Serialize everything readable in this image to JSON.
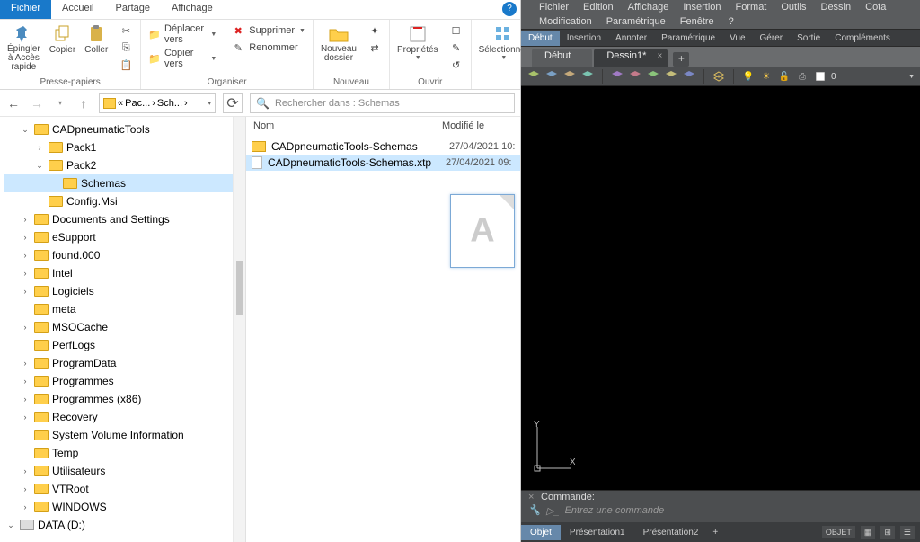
{
  "explorer": {
    "tabs": {
      "file": "Fichier",
      "home": "Accueil",
      "share": "Partage",
      "view": "Affichage"
    },
    "ribbon": {
      "pin": "Épingler à Accès rapide",
      "copy": "Copier",
      "paste": "Coller",
      "clipboard_group": "Presse-papiers",
      "move_to": "Déplacer vers",
      "copy_to": "Copier vers",
      "delete": "Supprimer",
      "rename": "Renommer",
      "organize_group": "Organiser",
      "new_folder": "Nouveau dossier",
      "new_group": "Nouveau",
      "properties": "Propriétés",
      "open_group": "Ouvrir",
      "select": "Sélectionner"
    },
    "breadcrumb": {
      "p1": "Pac...",
      "p2": "Sch..."
    },
    "search_placeholder": "Rechercher dans : Schemas",
    "columns": {
      "name": "Nom",
      "modified": "Modifié le"
    },
    "files": [
      {
        "icon": "folder",
        "name": "CADpneumaticTools-Schemas",
        "date": "27/04/2021 10:"
      },
      {
        "icon": "file",
        "name": "CADpneumaticTools-Schemas.xtp",
        "date": "27/04/2021 09:",
        "selected": true
      }
    ],
    "tree": [
      {
        "indent": 0,
        "chev": "down",
        "icon": "folder",
        "label": "CADpneumaticTools"
      },
      {
        "indent": 1,
        "chev": "right",
        "icon": "folder",
        "label": "Pack1"
      },
      {
        "indent": 1,
        "chev": "down",
        "icon": "folder",
        "label": "Pack2"
      },
      {
        "indent": 2,
        "chev": "none",
        "icon": "folder",
        "label": "Schemas",
        "selected": true
      },
      {
        "indent": 1,
        "chev": "none",
        "icon": "folder",
        "label": "Config.Msi"
      },
      {
        "indent": 0,
        "chev": "right",
        "icon": "folder",
        "label": "Documents and Settings"
      },
      {
        "indent": 0,
        "chev": "right",
        "icon": "folder",
        "label": "eSupport"
      },
      {
        "indent": 0,
        "chev": "right",
        "icon": "folder",
        "label": "found.000"
      },
      {
        "indent": 0,
        "chev": "right",
        "icon": "folder",
        "label": "Intel"
      },
      {
        "indent": 0,
        "chev": "right",
        "icon": "folder",
        "label": "Logiciels"
      },
      {
        "indent": 0,
        "chev": "none",
        "icon": "folder",
        "label": "meta"
      },
      {
        "indent": 0,
        "chev": "right",
        "icon": "folder",
        "label": "MSOCache"
      },
      {
        "indent": 0,
        "chev": "none",
        "icon": "folder",
        "label": "PerfLogs"
      },
      {
        "indent": 0,
        "chev": "right",
        "icon": "folder",
        "label": "ProgramData"
      },
      {
        "indent": 0,
        "chev": "right",
        "icon": "folder",
        "label": "Programmes"
      },
      {
        "indent": 0,
        "chev": "right",
        "icon": "folder",
        "label": "Programmes (x86)"
      },
      {
        "indent": 0,
        "chev": "right",
        "icon": "folder",
        "label": "Recovery"
      },
      {
        "indent": 0,
        "chev": "none",
        "icon": "folder",
        "label": "System Volume Information"
      },
      {
        "indent": 0,
        "chev": "none",
        "icon": "folder",
        "label": "Temp"
      },
      {
        "indent": 0,
        "chev": "right",
        "icon": "folder",
        "label": "Utilisateurs"
      },
      {
        "indent": 0,
        "chev": "right",
        "icon": "folder",
        "label": "VTRoot"
      },
      {
        "indent": 0,
        "chev": "right",
        "icon": "folder",
        "label": "WINDOWS"
      },
      {
        "indent": -1,
        "chev": "down",
        "icon": "drive",
        "label": "DATA (D:)"
      }
    ]
  },
  "cad": {
    "menu_row1": [
      "Fichier",
      "Edition",
      "Affichage",
      "Insertion",
      "Format",
      "Outils",
      "Dessin",
      "Cota"
    ],
    "menu_row2": [
      "Modification",
      "Paramétrique",
      "Fenêtre",
      "?"
    ],
    "ribbon_tabs": [
      "Début",
      "Insertion",
      "Annoter",
      "Paramétrique",
      "Vue",
      "Gérer",
      "Sortie",
      "Compléments"
    ],
    "doctabs": {
      "t1": "Début",
      "t2": "Dessin1*"
    },
    "layer_text": "0",
    "cmd_label": "Commande:",
    "cmd_placeholder": "Entrez une commande",
    "bottom_tabs": {
      "obj": "Objet",
      "p1": "Présentation1",
      "p2": "Présentation2"
    },
    "status_objet": "OBJET"
  }
}
